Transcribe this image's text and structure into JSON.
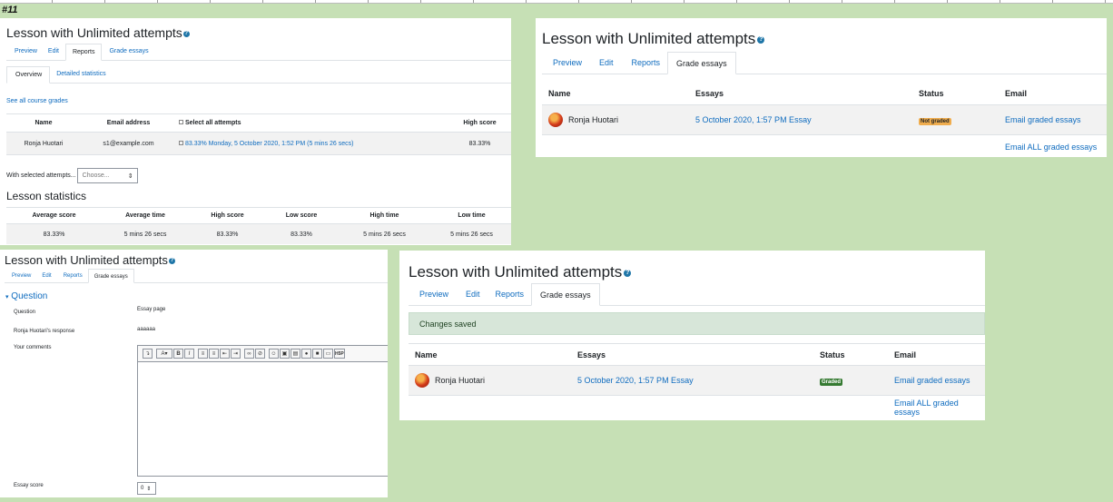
{
  "figure_label": "#11",
  "lesson_title": "Lesson with Unlimited attempts",
  "help_glyph": "?",
  "tabs": [
    "Preview",
    "Edit",
    "Reports",
    "Grade essays"
  ],
  "panel1": {
    "subtabs": [
      "Overview",
      "Detailed statistics"
    ],
    "course_grades_link": "See all course grades",
    "headers": [
      "Name",
      "Email address",
      "Select all attempts",
      "High score"
    ],
    "row": {
      "name": "Ronja Huotari",
      "email": "s1@example.com",
      "attempt": "83.33% Monday, 5 October 2020, 1:52 PM (5 mins 26 secs)",
      "high_score": "83.33%"
    },
    "with_selected_label": "With selected attempts...",
    "choose_value": "Choose...",
    "stats_heading": "Lesson statistics",
    "stats_headers": [
      "Average score",
      "Average time",
      "High score",
      "Low score",
      "High time",
      "Low time"
    ],
    "stats_values": [
      "83.33%",
      "5 mins 26 secs",
      "83.33%",
      "83.33%",
      "5 mins 26 secs",
      "5 mins 26 secs"
    ]
  },
  "grade_table": {
    "headers": [
      "Name",
      "Essays",
      "Status",
      "Email"
    ],
    "student": "Ronja Huotari",
    "essay_link": "5 October 2020, 1:57 PM Essay",
    "email_link": "Email graded essays",
    "email_all_link": "Email ALL graded essays"
  },
  "panel2": {
    "status": "Not graded",
    "status_color": "#f0ad4e"
  },
  "panel3": {
    "section": "Question",
    "question_label": "Question",
    "question_value": "Essay page",
    "response_label": "Ronja Huotari's response",
    "response_value": "aaaaaa",
    "comments_label": "Your comments",
    "score_label": "Essay score",
    "score_value": "0"
  },
  "panel4": {
    "notice": "Changes saved",
    "status": "Graded",
    "status_color": "#357a32"
  }
}
